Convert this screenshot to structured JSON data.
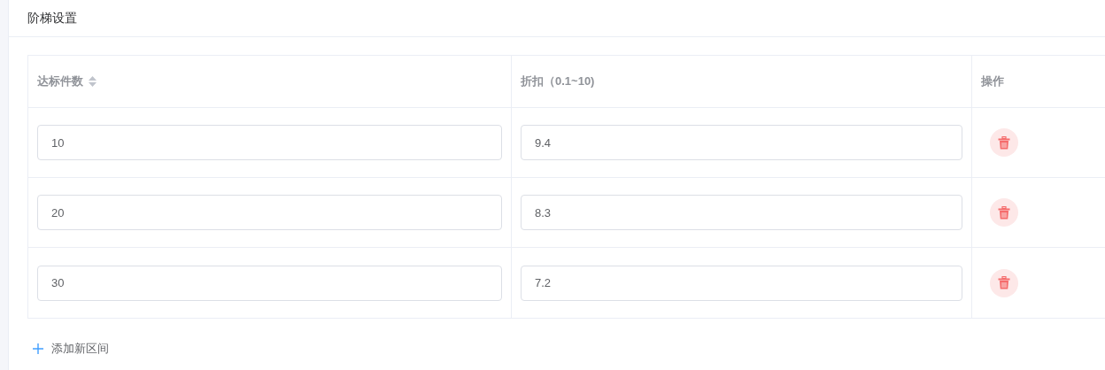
{
  "section": {
    "title": "阶梯设置"
  },
  "table": {
    "columns": [
      {
        "label": "达标件数",
        "sortable": true
      },
      {
        "label": "折扣（0.1~10)",
        "sortable": false
      },
      {
        "label": "操作",
        "sortable": false
      }
    ],
    "rows": [
      {
        "count": "10",
        "discount": "9.4"
      },
      {
        "count": "20",
        "discount": "8.3"
      },
      {
        "count": "30",
        "discount": "7.2"
      }
    ]
  },
  "add_button": {
    "label": "添加新区间"
  }
}
